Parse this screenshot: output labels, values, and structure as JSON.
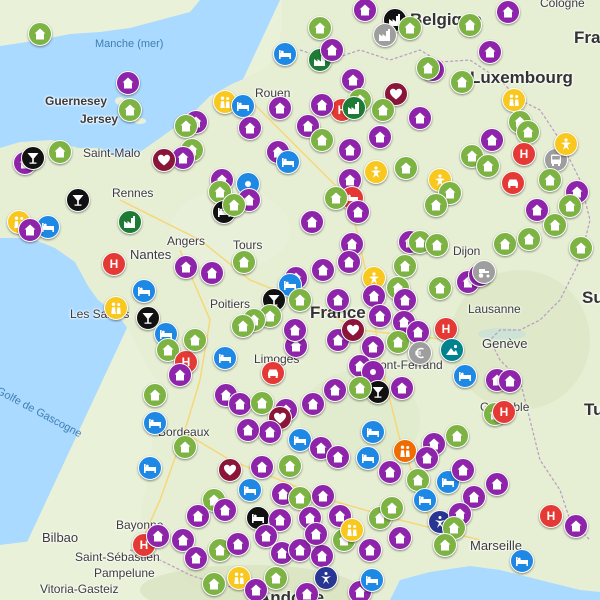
{
  "colors": {
    "purple": "#8e24aa",
    "green": "#7cb342",
    "red": "#e53935",
    "blue": "#1e88e5",
    "black": "#111111",
    "maroon": "#8a1538",
    "yellow": "#f9c81e",
    "grey": "#9e9e9e",
    "darkgreen": "#1e7b34",
    "navy": "#283593",
    "orange": "#ef6c00",
    "teal": "#00838f",
    "water": "#aadaff",
    "land": "#eaf1d9"
  },
  "labels": {
    "belgique": "Belgique",
    "luxembourg": "Luxembourg",
    "manche": "Manche (mer)",
    "guernesey": "Guernesey",
    "jersey": "Jersey",
    "rouen": "Rouen",
    "saint_malo": "Saint-Malo",
    "rennes": "Rennes",
    "angers": "Angers",
    "nantes": "Nantes",
    "tours": "Tours",
    "dijon": "Dijon",
    "les_sables": "Les Sables",
    "poitiers": "Poitiers",
    "france": "France",
    "lausanne": "Lausanne",
    "geneve": "Genève",
    "limoges": "Limoges",
    "clermont": "Clermont-Ferrand",
    "golfe": "Golfe de Gascogne",
    "bordeaux": "Bordeaux",
    "grenoble": "Grenoble",
    "bayonne": "Bayonne",
    "bilbao": "Bilbao",
    "saint_sebastien": "Saint-Sébastien",
    "pampelune": "Pampelune",
    "vitoria": "Vitoria-Gasteiz",
    "marseille": "Marseille",
    "andorre": "Andorre",
    "cologne": "Cologne",
    "fra": "Fra",
    "su": "Su",
    "tu": "Tu"
  },
  "pins": [
    [
      "green",
      "house",
      40,
      34
    ],
    [
      "purple",
      "house",
      128,
      83
    ],
    [
      "green",
      "house",
      130,
      110
    ],
    [
      "purple",
      "house",
      196,
      122
    ],
    [
      "green",
      "house",
      186,
      126
    ],
    [
      "yellow",
      "people",
      225,
      102
    ],
    [
      "blue",
      "bed",
      243,
      106
    ],
    [
      "purple",
      "house",
      250,
      128
    ],
    [
      "purple",
      "house",
      280,
      108
    ],
    [
      "blue",
      "bed",
      285,
      54
    ],
    [
      "darkgreen",
      "factory",
      320,
      60
    ],
    [
      "green",
      "house",
      320,
      28
    ],
    [
      "purple",
      "house",
      332,
      50
    ],
    [
      "black",
      "factory",
      395,
      20
    ],
    [
      "grey",
      "factory",
      385,
      35
    ],
    [
      "green",
      "house",
      410,
      28
    ],
    [
      "purple",
      "house",
      433,
      70
    ],
    [
      "green",
      "house",
      428,
      68
    ],
    [
      "purple",
      "house",
      490,
      52
    ],
    [
      "green",
      "house",
      462,
      82
    ],
    [
      "purple",
      "house",
      508,
      12
    ],
    [
      "green",
      "house",
      470,
      25
    ],
    [
      "purple",
      "house",
      365,
      10
    ],
    [
      "maroon",
      "heart",
      396,
      94
    ],
    [
      "purple",
      "house",
      353,
      80
    ],
    [
      "green",
      "house",
      383,
      110
    ],
    [
      "red",
      "H",
      342,
      110
    ],
    [
      "purple",
      "house",
      322,
      105
    ],
    [
      "green",
      "house",
      360,
      100
    ],
    [
      "darkgreen",
      "factory",
      354,
      108
    ],
    [
      "purple",
      "house",
      420,
      118
    ],
    [
      "purple",
      "house",
      380,
      137
    ],
    [
      "yellow",
      "people",
      514,
      100
    ],
    [
      "green",
      "house",
      520,
      122
    ],
    [
      "green",
      "house",
      528,
      132
    ],
    [
      "purple",
      "house",
      492,
      140
    ],
    [
      "red",
      "H",
      524,
      154
    ],
    [
      "grey",
      "bus",
      556,
      160
    ],
    [
      "yellow",
      "star",
      566,
      144
    ],
    [
      "green",
      "house",
      472,
      156
    ],
    [
      "green",
      "house",
      488,
      166
    ],
    [
      "red",
      "car",
      513,
      183
    ],
    [
      "green",
      "house",
      550,
      180
    ],
    [
      "purple",
      "house",
      577,
      192
    ],
    [
      "green",
      "house",
      570,
      206
    ],
    [
      "purple",
      "house",
      537,
      210
    ],
    [
      "yellow",
      "star",
      440,
      180
    ],
    [
      "green",
      "house",
      450,
      193
    ],
    [
      "green",
      "house",
      436,
      205
    ],
    [
      "purple",
      "house",
      308,
      126
    ],
    [
      "purple",
      "house",
      278,
      152
    ],
    [
      "blue",
      "bed",
      288,
      162
    ],
    [
      "green",
      "house",
      322,
      140
    ],
    [
      "purple",
      "house",
      350,
      150
    ],
    [
      "green",
      "house",
      406,
      168
    ],
    [
      "yellow",
      "star",
      376,
      172
    ],
    [
      "purple",
      "house",
      350,
      180
    ],
    [
      "red",
      "bed",
      352,
      198
    ],
    [
      "purple",
      "house",
      358,
      212
    ],
    [
      "green",
      "house",
      336,
      198
    ],
    [
      "purple",
      "house",
      312,
      222
    ],
    [
      "green",
      "house",
      192,
      150
    ],
    [
      "purple",
      "house",
      183,
      158
    ],
    [
      "maroon",
      "heart",
      164,
      160
    ],
    [
      "green",
      "house",
      60,
      152
    ],
    [
      "purple",
      "house",
      25,
      163
    ],
    [
      "black",
      "cocktail",
      33,
      158
    ],
    [
      "black",
      "cocktail",
      78,
      200
    ],
    [
      "darkgreen",
      "factory",
      130,
      222
    ],
    [
      "yellow",
      "people",
      19,
      222
    ],
    [
      "blue",
      "bed",
      48,
      227
    ],
    [
      "purple",
      "house",
      30,
      230
    ],
    [
      "purple",
      "house",
      222,
      180
    ],
    [
      "green",
      "house",
      220,
      192
    ],
    [
      "black",
      "bed",
      224,
      212
    ],
    [
      "blue",
      "pinmark",
      248,
      184
    ],
    [
      "purple",
      "house",
      249,
      200
    ],
    [
      "green",
      "house",
      234,
      205
    ],
    [
      "purple",
      "house",
      352,
      244
    ],
    [
      "purple",
      "house",
      349,
      262
    ],
    [
      "purple",
      "house",
      410,
      242
    ],
    [
      "green",
      "house",
      420,
      242
    ],
    [
      "green",
      "house",
      437,
      245
    ],
    [
      "green",
      "house",
      405,
      266
    ],
    [
      "purple",
      "house",
      468,
      282
    ],
    [
      "purple",
      "house",
      480,
      275
    ],
    [
      "grey",
      "tractor",
      484,
      272
    ],
    [
      "green",
      "house",
      505,
      244
    ],
    [
      "green",
      "house",
      529,
      239
    ],
    [
      "green",
      "house",
      555,
      225
    ],
    [
      "green",
      "house",
      581,
      248
    ],
    [
      "red",
      "H",
      114,
      264
    ],
    [
      "purple",
      "house",
      186,
      267
    ],
    [
      "purple",
      "house",
      212,
      273
    ],
    [
      "green",
      "house",
      244,
      262
    ],
    [
      "blue",
      "bed",
      144,
      291
    ],
    [
      "yellow",
      "people",
      116,
      308
    ],
    [
      "purple",
      "house",
      323,
      270
    ],
    [
      "purple",
      "house",
      296,
      278
    ],
    [
      "blue",
      "bed",
      290,
      285
    ],
    [
      "yellow",
      "star",
      374,
      278
    ],
    [
      "purple",
      "house",
      374,
      296
    ],
    [
      "green",
      "house",
      398,
      288
    ],
    [
      "purple",
      "house",
      405,
      300
    ],
    [
      "green",
      "house",
      440,
      288
    ],
    [
      "purple",
      "house",
      338,
      300
    ],
    [
      "black",
      "cocktail",
      274,
      300
    ],
    [
      "green",
      "house",
      300,
      300
    ],
    [
      "green",
      "house",
      270,
      316
    ],
    [
      "green",
      "house",
      254,
      320
    ],
    [
      "green",
      "house",
      243,
      326
    ],
    [
      "black",
      "cocktail",
      148,
      318
    ],
    [
      "blue",
      "bed",
      166,
      334
    ],
    [
      "green",
      "house",
      168,
      350
    ],
    [
      "red",
      "H",
      186,
      362
    ],
    [
      "purple",
      "house",
      180,
      375
    ],
    [
      "blue",
      "bed",
      225,
      358
    ],
    [
      "green",
      "house",
      195,
      340
    ],
    [
      "purple",
      "house",
      296,
      346
    ],
    [
      "purple",
      "house",
      295,
      330
    ],
    [
      "purple",
      "house",
      338,
      340
    ],
    [
      "maroon",
      "heart",
      353,
      330
    ],
    [
      "purple",
      "house",
      380,
      316
    ],
    [
      "purple",
      "house",
      404,
      322
    ],
    [
      "green",
      "house",
      398,
      342
    ],
    [
      "red",
      "H",
      446,
      329
    ],
    [
      "teal",
      "sun",
      452,
      350
    ],
    [
      "purple",
      "house",
      418,
      332
    ],
    [
      "grey",
      "euro",
      420,
      353
    ],
    [
      "purple",
      "house",
      373,
      347
    ],
    [
      "purple",
      "house",
      360,
      366
    ],
    [
      "purple",
      "pinmark",
      373,
      372
    ],
    [
      "black",
      "cocktail",
      378,
      392
    ],
    [
      "green",
      "house",
      360,
      388
    ],
    [
      "purple",
      "house",
      402,
      388
    ],
    [
      "blue",
      "bed",
      465,
      376
    ],
    [
      "purple",
      "house",
      497,
      380
    ],
    [
      "purple",
      "house",
      510,
      381
    ],
    [
      "green",
      "house",
      495,
      414
    ],
    [
      "red",
      "H",
      504,
      412
    ],
    [
      "red",
      "car",
      273,
      373
    ],
    [
      "purple",
      "house",
      226,
      395
    ],
    [
      "green",
      "house",
      155,
      395
    ],
    [
      "purple",
      "house",
      240,
      404
    ],
    [
      "green",
      "house",
      262,
      403
    ],
    [
      "purple",
      "house",
      286,
      410
    ],
    [
      "purple",
      "house",
      313,
      404
    ],
    [
      "purple",
      "house",
      335,
      390
    ],
    [
      "maroon",
      "heart",
      280,
      418
    ],
    [
      "purple",
      "house",
      270,
      432
    ],
    [
      "purple",
      "house",
      248,
      430
    ],
    [
      "blue",
      "bed",
      155,
      423
    ],
    [
      "green",
      "house",
      185,
      447
    ],
    [
      "blue",
      "bed",
      300,
      440
    ],
    [
      "purple",
      "house",
      321,
      448
    ],
    [
      "purple",
      "house",
      338,
      457
    ],
    [
      "blue",
      "bed",
      373,
      432
    ],
    [
      "blue",
      "bed",
      368,
      458
    ],
    [
      "green",
      "house",
      457,
      436
    ],
    [
      "purple",
      "house",
      434,
      444
    ],
    [
      "purple",
      "house",
      427,
      458
    ],
    [
      "orange",
      "people",
      405,
      451
    ],
    [
      "purple",
      "house",
      390,
      472
    ],
    [
      "green",
      "house",
      418,
      480
    ],
    [
      "blue",
      "bed",
      448,
      482
    ],
    [
      "purple",
      "house",
      474,
      497
    ],
    [
      "purple",
      "house",
      497,
      484
    ],
    [
      "blue",
      "bed",
      150,
      468
    ],
    [
      "maroon",
      "heart",
      230,
      470
    ],
    [
      "purple",
      "house",
      262,
      467
    ],
    [
      "green",
      "house",
      290,
      466
    ],
    [
      "blue",
      "bed",
      250,
      490
    ],
    [
      "purple",
      "house",
      283,
      494
    ],
    [
      "green",
      "house",
      300,
      498
    ],
    [
      "purple",
      "house",
      323,
      496
    ],
    [
      "purple",
      "house",
      340,
      516
    ],
    [
      "green",
      "house",
      214,
      500
    ],
    [
      "purple",
      "house",
      198,
      516
    ],
    [
      "purple",
      "house",
      225,
      510
    ],
    [
      "black",
      "bed",
      258,
      518
    ],
    [
      "purple",
      "house",
      280,
      520
    ],
    [
      "purple",
      "house",
      310,
      518
    ],
    [
      "green",
      "house",
      380,
      518
    ],
    [
      "blue",
      "bed",
      425,
      500
    ],
    [
      "navy",
      "dancer",
      440,
      522
    ],
    [
      "purple",
      "house",
      460,
      514
    ],
    [
      "green",
      "house",
      454,
      528
    ],
    [
      "red",
      "H",
      551,
      516
    ],
    [
      "purple",
      "house",
      576,
      526
    ],
    [
      "red",
      "H",
      144,
      545
    ],
    [
      "purple",
      "house",
      158,
      536
    ],
    [
      "purple",
      "house",
      183,
      540
    ],
    [
      "purple",
      "house",
      196,
      558
    ],
    [
      "green",
      "house",
      220,
      550
    ],
    [
      "purple",
      "house",
      238,
      544
    ],
    [
      "purple",
      "house",
      266,
      536
    ],
    [
      "purple",
      "house",
      282,
      553
    ],
    [
      "purple",
      "house",
      300,
      550
    ],
    [
      "purple",
      "house",
      322,
      556
    ],
    [
      "green",
      "house",
      344,
      540
    ],
    [
      "purple",
      "house",
      370,
      550
    ],
    [
      "blue",
      "bed",
      522,
      561
    ],
    [
      "green",
      "house",
      445,
      545
    ],
    [
      "green",
      "house",
      214,
      584
    ],
    [
      "yellow",
      "people",
      239,
      578
    ],
    [
      "green",
      "house",
      276,
      578
    ],
    [
      "navy",
      "dancer",
      326,
      578
    ],
    [
      "purple",
      "house",
      360,
      592
    ],
    [
      "purple",
      "house",
      307,
      594
    ],
    [
      "blue",
      "bed",
      372,
      580
    ],
    [
      "purple",
      "house",
      316,
      534
    ],
    [
      "purple",
      "house",
      256,
      590
    ],
    [
      "yellow",
      "people",
      352,
      530
    ],
    [
      "purple",
      "house",
      400,
      538
    ],
    [
      "green",
      "house",
      392,
      508
    ],
    [
      "purple",
      "house",
      463,
      470
    ]
  ]
}
